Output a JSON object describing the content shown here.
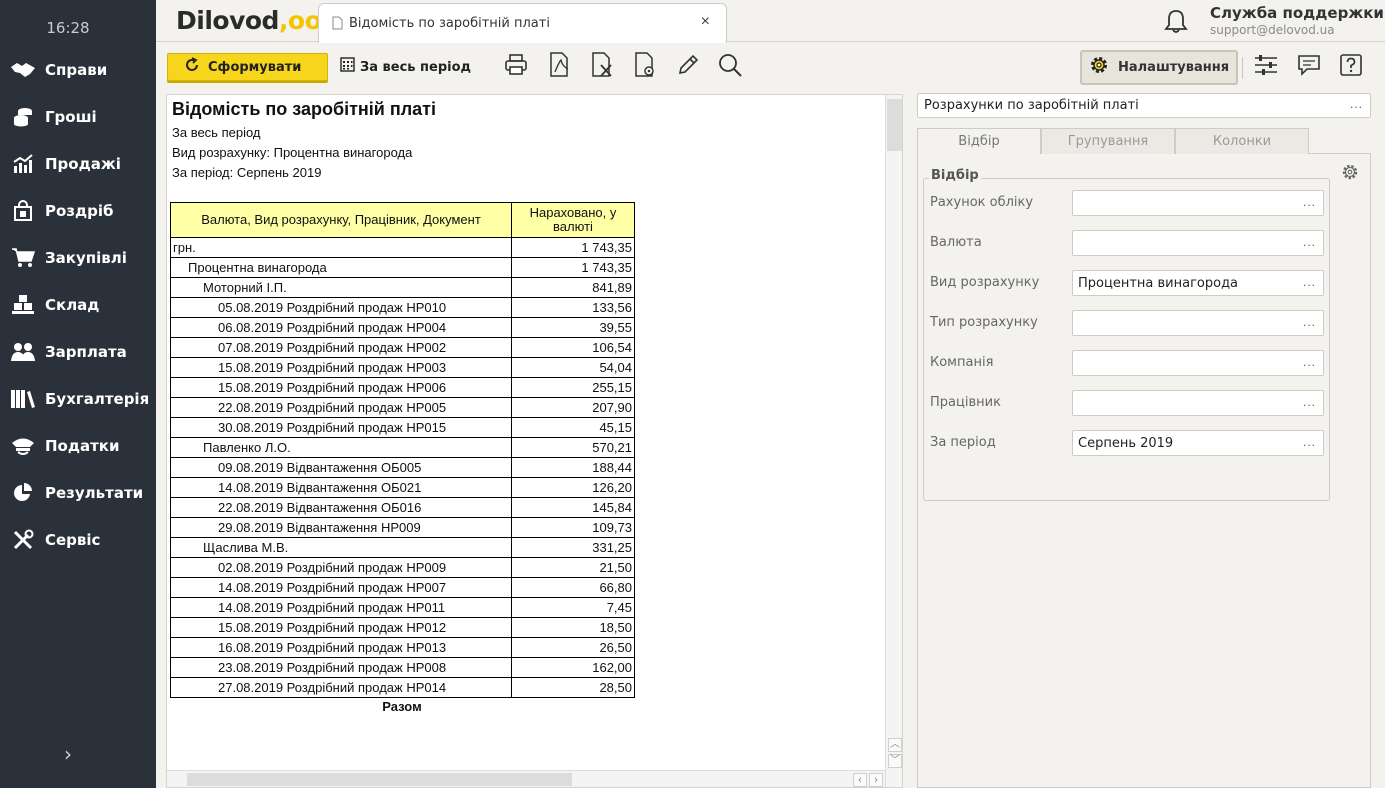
{
  "sidebar": {
    "clock": "16:28",
    "items": [
      {
        "label": "Справи",
        "icon": "handshake-icon"
      },
      {
        "label": "Гроші",
        "icon": "coins-icon"
      },
      {
        "label": "Продажі",
        "icon": "sales-chart-icon"
      },
      {
        "label": "Роздріб",
        "icon": "shopping-bag-icon"
      },
      {
        "label": "Закупівлі",
        "icon": "cart-icon"
      },
      {
        "label": "Склад",
        "icon": "boxes-icon"
      },
      {
        "label": "Зарплата",
        "icon": "people-icon"
      },
      {
        "label": "Бухгалтерія",
        "icon": "binders-icon"
      },
      {
        "label": "Податки",
        "icon": "officer-cap-icon"
      },
      {
        "label": "Результати",
        "icon": "pie-chart-icon"
      },
      {
        "label": "Сервіс",
        "icon": "tools-icon"
      }
    ],
    "collapse": "›"
  },
  "header": {
    "logo": "Dilovod",
    "logo_dots": ",oo",
    "tab_title": "Відомість по заробітній платі",
    "tab_close": "×",
    "support_title": "Служба поддержки",
    "support_email": "support@delovod.ua"
  },
  "toolbar": {
    "generate_label": "Сформувати",
    "period_label": "За весь період",
    "settings_label": "Налаштування",
    "accent": "#f7d51d"
  },
  "report": {
    "title": "Відомість по заробітній платі",
    "line1": "За весь період",
    "line2": "Вид розрахунку:  Процентна винагорода",
    "line3": "За період:  Серпень 2019",
    "col1": "Валюта, Вид розрахунку, Працівник, Документ",
    "col2": "Нараховано, у валюті",
    "rows": [
      {
        "text": "грн.",
        "value": "1 743,35",
        "level": 0
      },
      {
        "text": "Процентна винагорода",
        "value": "1 743,35",
        "level": 1
      },
      {
        "text": "Моторний І.П.",
        "value": "841,89",
        "level": 2
      },
      {
        "text": "05.08.2019 Роздрібний продаж НР010",
        "value": "133,56",
        "level": 3
      },
      {
        "text": "06.08.2019 Роздрібний продаж НР004",
        "value": "39,55",
        "level": 3
      },
      {
        "text": "07.08.2019 Роздрібний продаж НР002",
        "value": "106,54",
        "level": 3
      },
      {
        "text": "15.08.2019 Роздрібний продаж НР003",
        "value": "54,04",
        "level": 3
      },
      {
        "text": "15.08.2019 Роздрібний продаж НР006",
        "value": "255,15",
        "level": 3
      },
      {
        "text": "22.08.2019 Роздрібний продаж НР005",
        "value": "207,90",
        "level": 3
      },
      {
        "text": "30.08.2019 Роздрібний продаж НР015",
        "value": "45,15",
        "level": 3
      },
      {
        "text": "Павленко Л.О.",
        "value": "570,21",
        "level": 2
      },
      {
        "text": "09.08.2019 Відвантаження ОБ005",
        "value": "188,44",
        "level": 3
      },
      {
        "text": "14.08.2019 Відвантаження ОБ021",
        "value": "126,20",
        "level": 3
      },
      {
        "text": "22.08.2019 Відвантаження ОБ016",
        "value": "145,84",
        "level": 3
      },
      {
        "text": "29.08.2019 Відвантаження НР009",
        "value": "109,73",
        "level": 3
      },
      {
        "text": "Щаслива М.В.",
        "value": "331,25",
        "level": 2
      },
      {
        "text": "02.08.2019 Роздрібний продаж НР009",
        "value": "21,50",
        "level": 3
      },
      {
        "text": "14.08.2019 Роздрібний продаж НР007",
        "value": "66,80",
        "level": 3
      },
      {
        "text": "14.08.2019 Роздрібний продаж НР011",
        "value": "7,45",
        "level": 3
      },
      {
        "text": "15.08.2019 Роздрібний продаж НР012",
        "value": "18,50",
        "level": 3
      },
      {
        "text": "16.08.2019 Роздрібний продаж НР013",
        "value": "26,50",
        "level": 3
      },
      {
        "text": "23.08.2019 Роздрібний продаж НР008",
        "value": "162,00",
        "level": 3
      },
      {
        "text": "27.08.2019 Роздрібний продаж НР014",
        "value": "28,50",
        "level": 3
      }
    ],
    "total_label": "Разом"
  },
  "panel": {
    "report_select": "Розрахунки по заробітній платі",
    "dots": "...",
    "tabs": [
      "Відбір",
      "Групування",
      "Колонки"
    ],
    "group_title": "Відбір",
    "fields": [
      {
        "label": "Рахунок обліку",
        "value": ""
      },
      {
        "label": "Валюта",
        "value": ""
      },
      {
        "label": "Вид розрахунку",
        "value": "Процентна винагорода"
      },
      {
        "label": "Тип розрахунку",
        "value": ""
      },
      {
        "label": "Компанія",
        "value": ""
      },
      {
        "label": "Працівник",
        "value": ""
      },
      {
        "label": "За період",
        "value": "Серпень 2019"
      }
    ]
  }
}
